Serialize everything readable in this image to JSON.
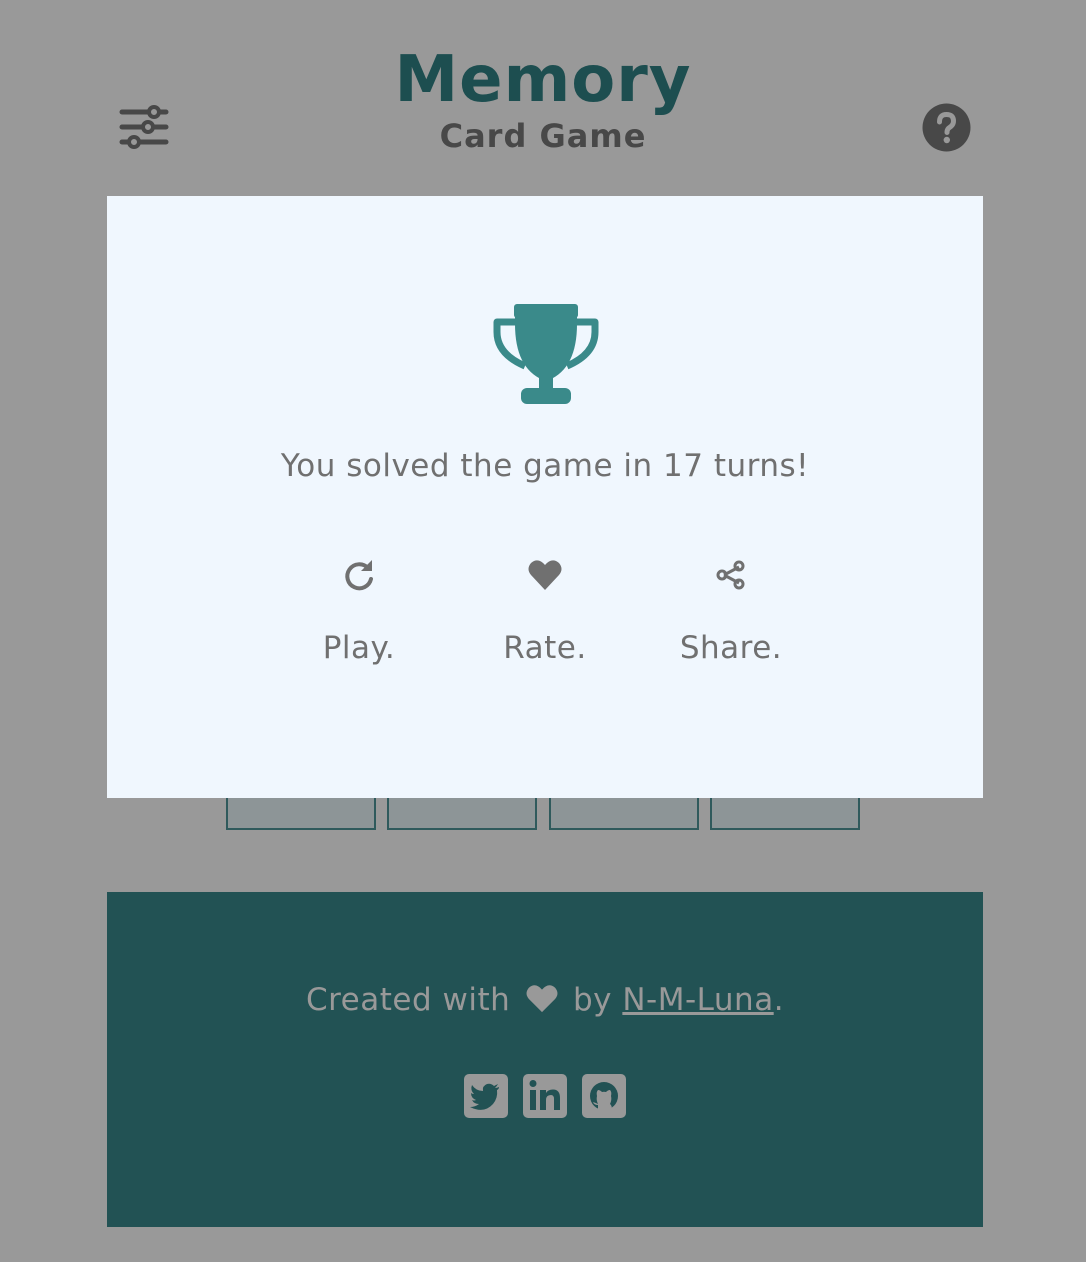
{
  "header": {
    "title": "Memory",
    "subtitle": "Card Game",
    "settings_icon": "sliders-icon",
    "help_icon": "question-circle-icon"
  },
  "modal": {
    "icon": "trophy-icon",
    "message": "You solved the game in 17 turns!",
    "actions": [
      {
        "label": "Play.",
        "icon": "redo-icon"
      },
      {
        "label": "Rate.",
        "icon": "heart-icon"
      },
      {
        "label": "Share.",
        "icon": "share-icon"
      }
    ]
  },
  "footer": {
    "credit_prefix": "Created with",
    "credit_by": "by",
    "author": "N-M-Luna",
    "credit_suffix": ".",
    "social": [
      {
        "icon": "twitter-icon"
      },
      {
        "icon": "linkedin-icon"
      },
      {
        "icon": "github-icon"
      }
    ]
  },
  "colors": {
    "backdrop": "#999999",
    "title": "#1d4e50",
    "subtitle": "#484848",
    "modal_bg": "#f0f7fe",
    "accent": "#3a8a8a",
    "muted_text": "#707070",
    "footer_bg": "#225254"
  }
}
